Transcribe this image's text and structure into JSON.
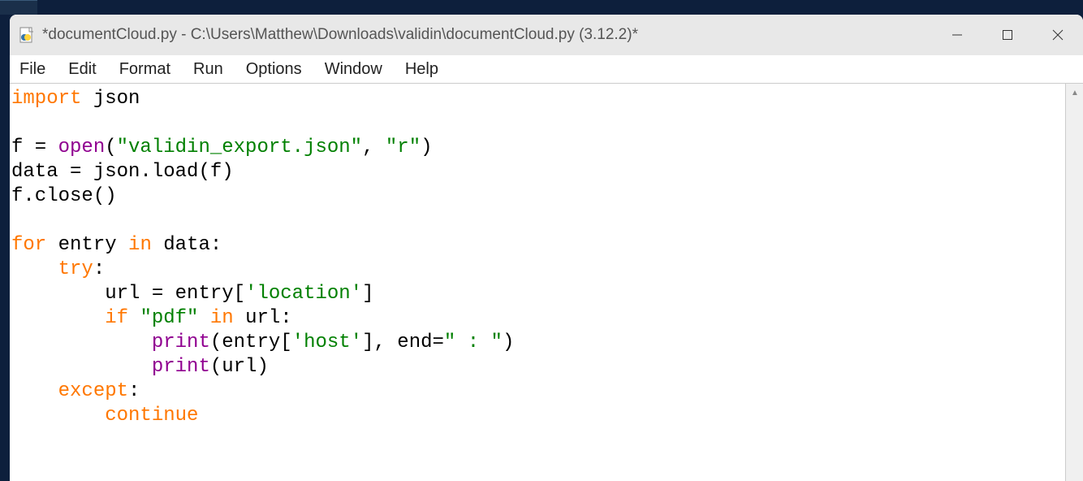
{
  "window": {
    "title": "*documentCloud.py - C:\\Users\\Matthew\\Downloads\\validin\\documentCloud.py (3.12.2)*"
  },
  "menubar": {
    "items": [
      "File",
      "Edit",
      "Format",
      "Run",
      "Options",
      "Window",
      "Help"
    ]
  },
  "code": {
    "tokens": [
      [
        {
          "t": "import",
          "c": "kw-orange"
        },
        {
          "t": " json",
          "c": "plain"
        }
      ],
      [],
      [
        {
          "t": "f = ",
          "c": "plain"
        },
        {
          "t": "open",
          "c": "kw-purple"
        },
        {
          "t": "(",
          "c": "plain"
        },
        {
          "t": "\"validin_export.json\"",
          "c": "kw-green"
        },
        {
          "t": ", ",
          "c": "plain"
        },
        {
          "t": "\"r\"",
          "c": "kw-green"
        },
        {
          "t": ")",
          "c": "plain"
        }
      ],
      [
        {
          "t": "data = json.load(f)",
          "c": "plain"
        }
      ],
      [
        {
          "t": "f.close()",
          "c": "plain"
        }
      ],
      [],
      [
        {
          "t": "for",
          "c": "kw-orange"
        },
        {
          "t": " entry ",
          "c": "plain"
        },
        {
          "t": "in",
          "c": "kw-orange"
        },
        {
          "t": " data:",
          "c": "plain"
        }
      ],
      [
        {
          "t": "    ",
          "c": "plain"
        },
        {
          "t": "try",
          "c": "kw-orange"
        },
        {
          "t": ":",
          "c": "plain"
        }
      ],
      [
        {
          "t": "        url = entry[",
          "c": "plain"
        },
        {
          "t": "'location'",
          "c": "kw-green"
        },
        {
          "t": "]",
          "c": "plain"
        }
      ],
      [
        {
          "t": "        ",
          "c": "plain"
        },
        {
          "t": "if",
          "c": "kw-orange"
        },
        {
          "t": " ",
          "c": "plain"
        },
        {
          "t": "\"pdf\"",
          "c": "kw-green"
        },
        {
          "t": " ",
          "c": "plain"
        },
        {
          "t": "in",
          "c": "kw-orange"
        },
        {
          "t": " url:",
          "c": "plain"
        }
      ],
      [
        {
          "t": "            ",
          "c": "plain"
        },
        {
          "t": "print",
          "c": "kw-purple"
        },
        {
          "t": "(entry[",
          "c": "plain"
        },
        {
          "t": "'host'",
          "c": "kw-green"
        },
        {
          "t": "], end=",
          "c": "plain"
        },
        {
          "t": "\" : \"",
          "c": "kw-green"
        },
        {
          "t": ")",
          "c": "plain"
        }
      ],
      [
        {
          "t": "            ",
          "c": "plain"
        },
        {
          "t": "print",
          "c": "kw-purple"
        },
        {
          "t": "(url)",
          "c": "plain"
        }
      ],
      [
        {
          "t": "    ",
          "c": "plain"
        },
        {
          "t": "except",
          "c": "kw-orange"
        },
        {
          "t": ":",
          "c": "plain"
        }
      ],
      [
        {
          "t": "        ",
          "c": "plain"
        },
        {
          "t": "continue",
          "c": "kw-orange"
        }
      ]
    ]
  }
}
